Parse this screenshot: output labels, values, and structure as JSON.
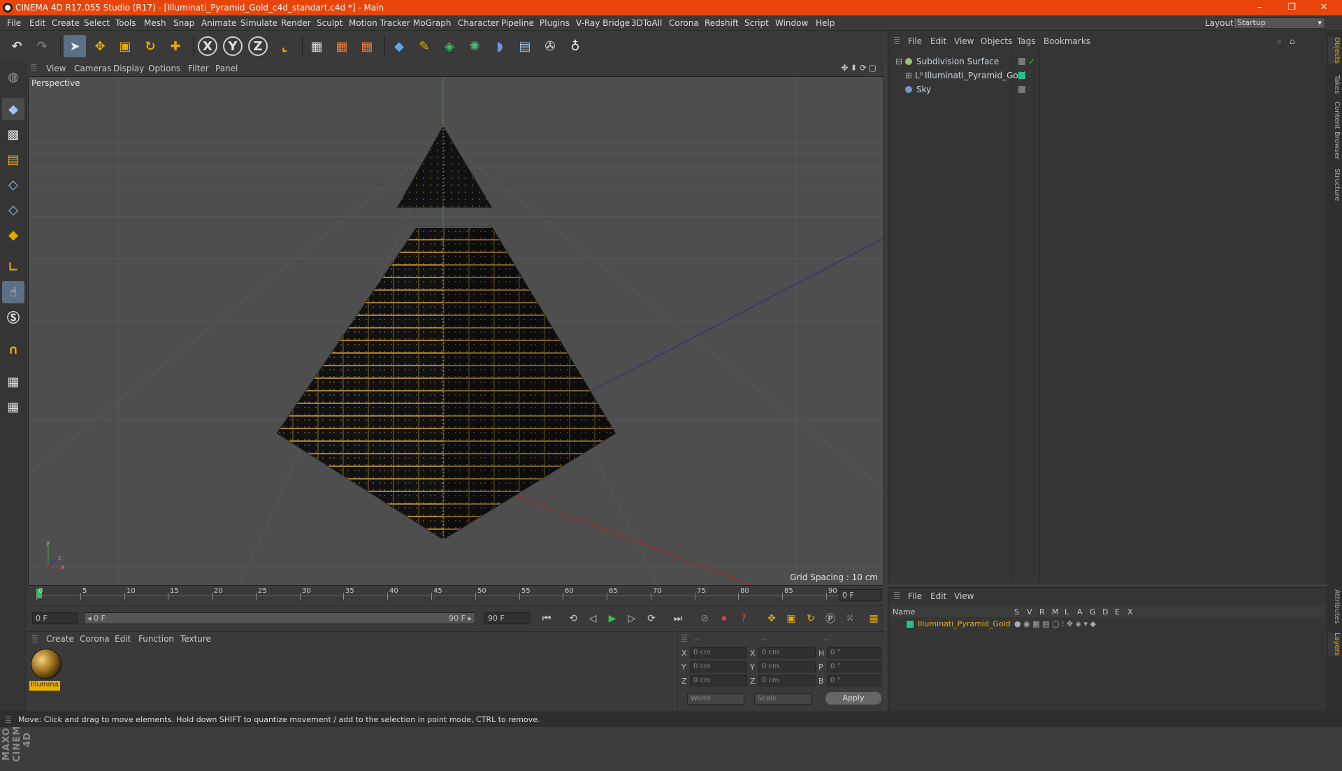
{
  "window": {
    "title": "CINEMA 4D R17.055 Studio (R17) - [Illuminati_Pyramid_Gold_c4d_standart.c4d *] - Main",
    "controls": [
      "–",
      "❐",
      "✕"
    ]
  },
  "menubar": {
    "items": [
      "File",
      "Edit",
      "Create",
      "Select",
      "Tools",
      "Mesh",
      "Snap",
      "Animate",
      "Simulate",
      "Render",
      "Sculpt",
      "Motion Tracker",
      "MoGraph",
      "Character",
      "Pipeline",
      "Plugins",
      "V-Ray Bridge",
      "3DToAll",
      "Corona",
      "Redshift",
      "Script",
      "Window",
      "Help"
    ],
    "layout_label": "Layout:",
    "layout_value": "Startup"
  },
  "toolbar": {
    "axis_x": "X",
    "axis_y": "Y",
    "axis_z": "Z"
  },
  "viewport": {
    "menu": [
      "View",
      "Cameras",
      "Display",
      "Options",
      "Filter",
      "Panel"
    ],
    "label": "Perspective",
    "grid_spacing": "Grid Spacing : 10 cm",
    "axes": {
      "x": "x",
      "y": "y",
      "z": "z"
    }
  },
  "timeline": {
    "ticks": [
      "0",
      "5",
      "10",
      "15",
      "20",
      "25",
      "30",
      "35",
      "40",
      "45",
      "50",
      "55",
      "60",
      "65",
      "70",
      "75",
      "80",
      "85",
      "90"
    ],
    "current_frame": "0 F",
    "start_field": "0 F",
    "range_start": "◂ 0 F",
    "range_end": "90 F ▸",
    "end_field": "90 F"
  },
  "material_manager": {
    "menu": [
      "Create",
      "Corona",
      "Edit",
      "Function",
      "Texture"
    ],
    "material_name": "Illumina"
  },
  "coordinates": {
    "headers": [
      "--",
      "--",
      "--"
    ],
    "rows": [
      {
        "a": "X",
        "av": "0 cm",
        "b": "X",
        "bv": "0 cm",
        "c": "H",
        "cv": "0 °"
      },
      {
        "a": "Y",
        "av": "0 cm",
        "b": "Y",
        "bv": "0 cm",
        "c": "P",
        "cv": "0 °"
      },
      {
        "a": "Z",
        "av": "0 cm",
        "b": "Z",
        "bv": "0 cm",
        "c": "B",
        "cv": "0 °"
      }
    ],
    "mode1": "World",
    "mode2": "Scale",
    "apply": "Apply"
  },
  "object_manager": {
    "menu": [
      "File",
      "Edit",
      "View",
      "Objects",
      "Tags",
      "Bookmarks"
    ],
    "objects": [
      {
        "name": "Subdivision Surface",
        "color": "#9ac27a"
      },
      {
        "name": "Illuminati_Pyramid_Gold",
        "color": "#24c08c"
      },
      {
        "name": "Sky",
        "color": "#6f9bd1"
      }
    ]
  },
  "layer_manager": {
    "menu": [
      "File",
      "Edit",
      "View"
    ],
    "headers": [
      "Name",
      "S",
      "V",
      "R",
      "M",
      "L",
      "A",
      "G",
      "D",
      "E",
      "X"
    ],
    "layer_name": "Illuminati_Pyramid_Gold",
    "layer_color": "#24c08c"
  },
  "side_tabs": [
    "Objects",
    "Takes",
    "Content Browser",
    "Structure",
    "Attributes",
    "Layers"
  ],
  "status": "Move: Click and drag to move elements. Hold down SHIFT to quantize movement / add to the selection in point mode, CTRL to remove."
}
